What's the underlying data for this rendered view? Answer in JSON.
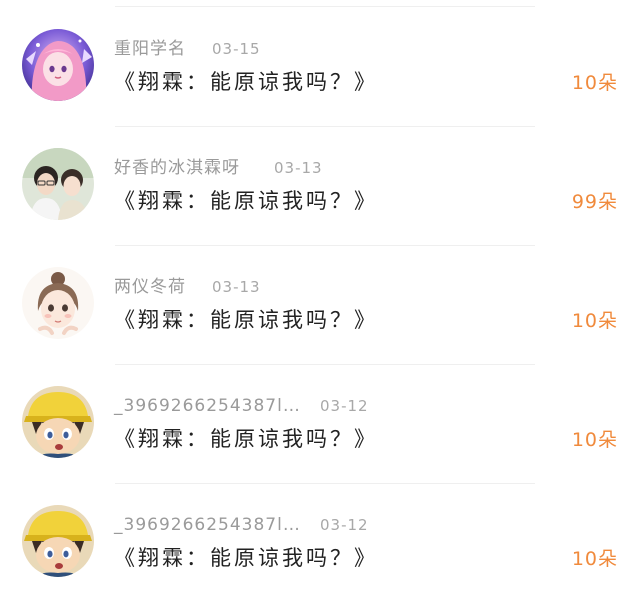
{
  "items": [
    {
      "username": "重阳学名",
      "time": "03-15",
      "message": "《翔霖：能原谅我吗？》",
      "count": "10朵",
      "avatar": "anime-girl-pink-hair"
    },
    {
      "username": "好香的冰淇霖呀",
      "time": "03-13",
      "message": "《翔霖：能原谅我吗？》",
      "count": "99朵",
      "avatar": "couple-photo"
    },
    {
      "username": "两仪冬荷",
      "time": "03-13",
      "message": "《翔霖：能原谅我吗？》",
      "count": "10朵",
      "avatar": "illustrated-girl"
    },
    {
      "username": "_3969266254387l…",
      "time": "03-12",
      "message": "《翔霖：能原谅我吗？》",
      "count": "10朵",
      "avatar": "anime-boy-yellow-hat"
    },
    {
      "username": "_3969266254387l…",
      "time": "03-12",
      "message": "《翔霖：能原谅我吗？》",
      "count": "10朵",
      "avatar": "anime-boy-yellow-hat"
    }
  ],
  "colors": {
    "accent": "#f08a3c",
    "username": "#9a9a9a",
    "message": "#222222",
    "divider": "#efefef"
  }
}
